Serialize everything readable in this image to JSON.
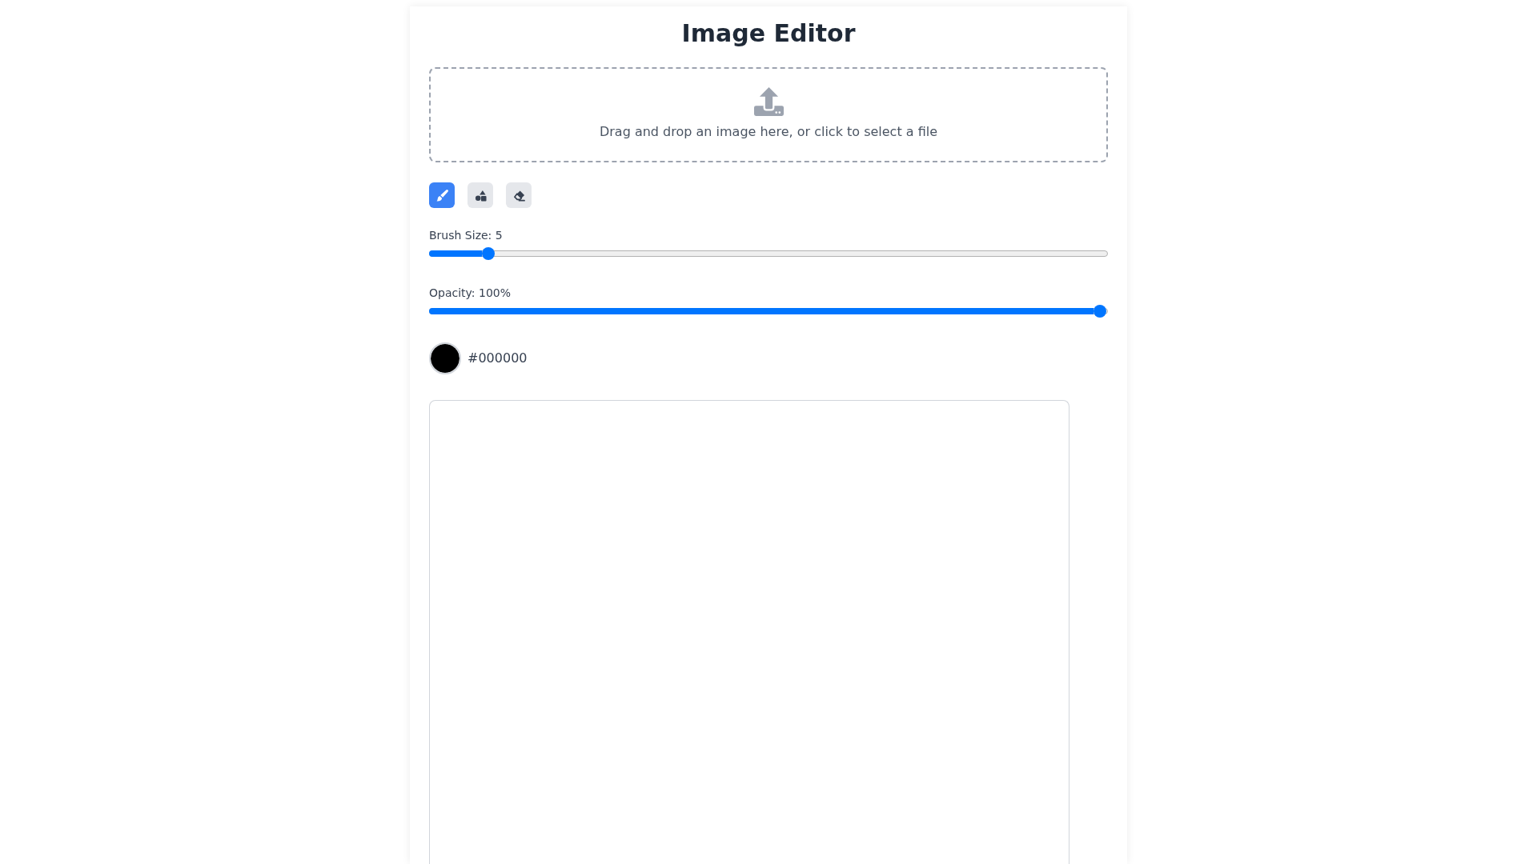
{
  "title": "Image Editor",
  "dropzone": {
    "text": "Drag and drop an image here, or click to select a file"
  },
  "tools": [
    {
      "kind": "brush",
      "selected": true
    },
    {
      "kind": "shapes",
      "selected": false
    },
    {
      "kind": "eraser",
      "selected": false
    }
  ],
  "sliders": [
    {
      "label": "Brush Size: 5",
      "level": 0.08
    },
    {
      "label": "Opacity: 100%",
      "level": 1
    }
  ],
  "color_picker": {
    "color": "#000000",
    "value": "#000000"
  }
}
